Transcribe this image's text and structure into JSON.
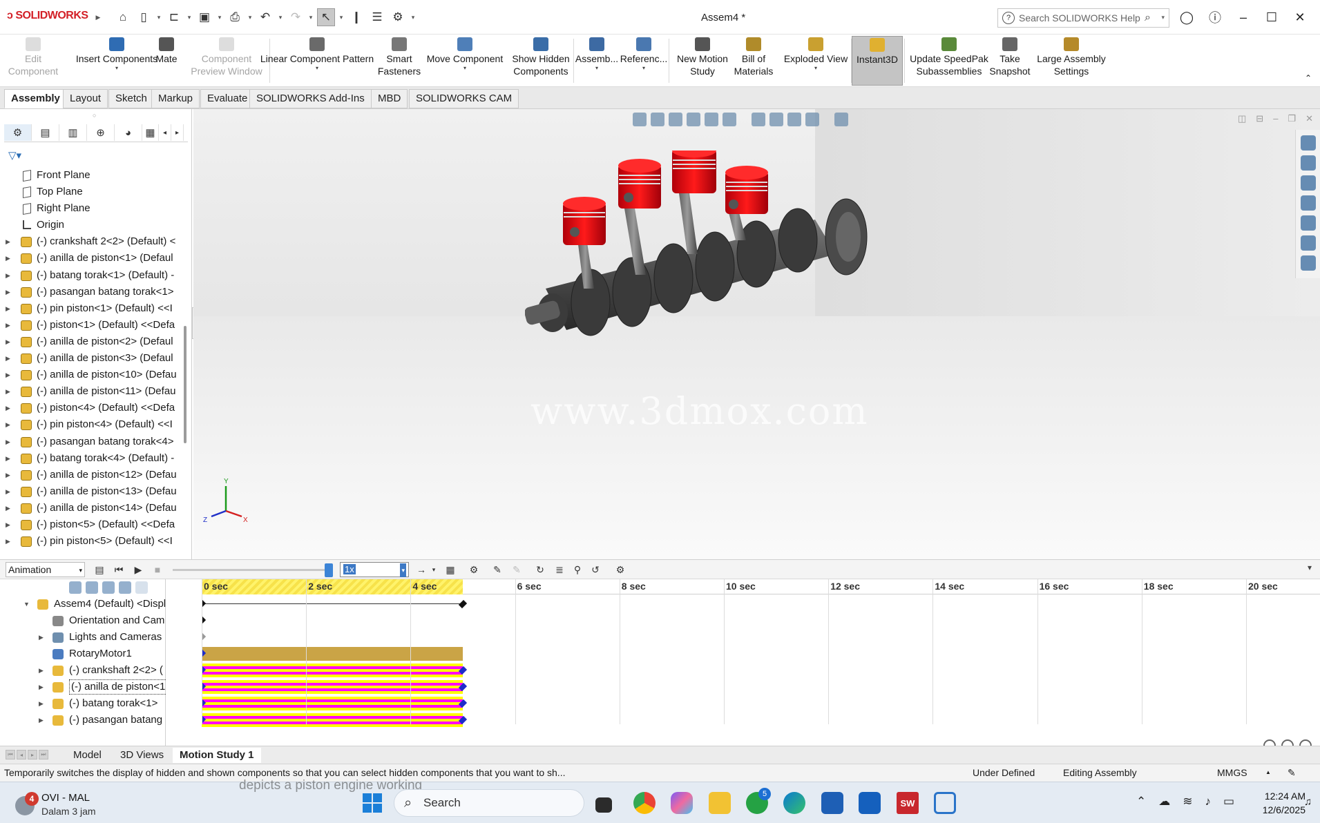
{
  "app": {
    "logo": "SOLIDWORKS",
    "document_title": "Assem4 *",
    "help_search_placeholder": "Search SOLIDWORKS Help",
    "help_icon": "?"
  },
  "command_manager": {
    "buttons": [
      {
        "id": "edit-component",
        "line1": "Edit",
        "line2": "Component",
        "disabled": true,
        "dropdown": false
      },
      {
        "id": "insert-components",
        "line1": "Insert Components",
        "line2": "",
        "disabled": false,
        "dropdown": true
      },
      {
        "id": "mate",
        "line1": "Mate",
        "line2": "",
        "disabled": false,
        "dropdown": false
      },
      {
        "id": "component-preview-window",
        "line1": "Component",
        "line2": "Preview Window",
        "disabled": true,
        "dropdown": false
      },
      {
        "id": "linear-component-pattern",
        "line1": "Linear Component Pattern",
        "line2": "",
        "disabled": false,
        "dropdown": true
      },
      {
        "id": "smart-fasteners",
        "line1": "Smart",
        "line2": "Fasteners",
        "disabled": false,
        "dropdown": false
      },
      {
        "id": "move-component",
        "line1": "Move Component",
        "line2": "",
        "disabled": false,
        "dropdown": true
      },
      {
        "id": "show-hidden-components",
        "line1": "Show Hidden",
        "line2": "Components",
        "disabled": false,
        "dropdown": false
      },
      {
        "id": "assembly",
        "line1": "Assemb...",
        "line2": "",
        "disabled": false,
        "dropdown": true
      },
      {
        "id": "reference",
        "line1": "Referenc...",
        "line2": "",
        "disabled": false,
        "dropdown": true
      },
      {
        "id": "new-motion-study",
        "line1": "New Motion",
        "line2": "Study",
        "disabled": false,
        "dropdown": false
      },
      {
        "id": "bill-of-materials",
        "line1": "Bill of",
        "line2": "Materials",
        "disabled": false,
        "dropdown": false
      },
      {
        "id": "exploded-view",
        "line1": "Exploded View",
        "line2": "",
        "disabled": false,
        "dropdown": true
      },
      {
        "id": "instant3d",
        "line1": "Instant3D",
        "line2": "",
        "disabled": false,
        "dropdown": false
      },
      {
        "id": "update-speedpak",
        "line1": "Update SpeedPak",
        "line2": "Subassemblies",
        "disabled": false,
        "dropdown": false
      },
      {
        "id": "take-snapshot",
        "line1": "Take",
        "line2": "Snapshot",
        "disabled": false,
        "dropdown": false
      },
      {
        "id": "large-assembly-settings",
        "line1": "Large Assembly",
        "line2": "Settings",
        "disabled": false,
        "dropdown": false
      }
    ]
  },
  "tabs": [
    "Assembly",
    "Layout",
    "Sketch",
    "Markup",
    "Evaluate",
    "SOLIDWORKS Add-Ins",
    "MBD",
    "SOLIDWORKS CAM"
  ],
  "active_tab": "Assembly",
  "feature_tree": [
    {
      "label": "Front Plane",
      "type": "plane",
      "expandable": false
    },
    {
      "label": "Top Plane",
      "type": "plane",
      "expandable": false
    },
    {
      "label": "Right Plane",
      "type": "plane",
      "expandable": false
    },
    {
      "label": "Origin",
      "type": "origin",
      "expandable": false
    },
    {
      "label": "(-) crankshaft 2<2> (Default) <",
      "type": "part",
      "expandable": true
    },
    {
      "label": "(-) anilla de piston<1> (Defaul",
      "type": "part",
      "expandable": true
    },
    {
      "label": "(-) batang torak<1> (Default) -",
      "type": "part",
      "expandable": true
    },
    {
      "label": "(-) pasangan batang torak<1>",
      "type": "part",
      "expandable": true
    },
    {
      "label": "(-) pin piston<1> (Default) <<I",
      "type": "part",
      "expandable": true
    },
    {
      "label": "(-) piston<1> (Default) <<Defa",
      "type": "part",
      "expandable": true
    },
    {
      "label": "(-) anilla de piston<2> (Defaul",
      "type": "part",
      "expandable": true
    },
    {
      "label": "(-) anilla de piston<3> (Defaul",
      "type": "part",
      "expandable": true
    },
    {
      "label": "(-) anilla de piston<10> (Defau",
      "type": "part",
      "expandable": true
    },
    {
      "label": "(-) anilla de piston<11> (Defau",
      "type": "part",
      "expandable": true
    },
    {
      "label": "(-) piston<4> (Default) <<Defa",
      "type": "part",
      "expandable": true
    },
    {
      "label": "(-) pin piston<4> (Default) <<I",
      "type": "part",
      "expandable": true
    },
    {
      "label": "(-) pasangan batang torak<4>",
      "type": "part",
      "expandable": true
    },
    {
      "label": "(-) batang torak<4> (Default) -",
      "type": "part",
      "expandable": true
    },
    {
      "label": "(-) anilla de piston<12> (Defau",
      "type": "part",
      "expandable": true
    },
    {
      "label": "(-) anilla de piston<13> (Defau",
      "type": "part",
      "expandable": true
    },
    {
      "label": "(-) anilla de piston<14> (Defau",
      "type": "part",
      "expandable": true
    },
    {
      "label": "(-) piston<5> (Default) <<Defa",
      "type": "part",
      "expandable": true
    },
    {
      "label": "(-) pin piston<5> (Default) <<I",
      "type": "part",
      "expandable": true
    }
  ],
  "viewport": {
    "watermark": "www.3dmox.com",
    "triad": {
      "x": "X",
      "y": "Y",
      "z": "Z"
    }
  },
  "motion_manager": {
    "study_type": "Animation",
    "speed": "1x",
    "time_ticks": [
      "0 sec",
      "2 sec",
      "4 sec",
      "6 sec",
      "8 sec",
      "10 sec",
      "12 sec",
      "14 sec",
      "16 sec",
      "18 sec",
      "20 sec"
    ],
    "duration_sec": 5,
    "tree": [
      {
        "label": "Assem4 (Default) <Displ",
        "indent": 0,
        "expandable": true,
        "expanded": true,
        "icon": "assembly",
        "track": "key"
      },
      {
        "label": "Orientation and Cam",
        "indent": 1,
        "expandable": false,
        "icon": "orientation",
        "track": "key-start"
      },
      {
        "label": "Lights and Cameras",
        "indent": 1,
        "expandable": true,
        "icon": "lights",
        "track": "key-grey"
      },
      {
        "label": "RotaryMotor1",
        "indent": 1,
        "expandable": false,
        "icon": "motor",
        "track": "motor"
      },
      {
        "label": "(-) crankshaft 2<2> (",
        "indent": 1,
        "expandable": true,
        "icon": "part",
        "track": "component"
      },
      {
        "label": "(-) anilla de piston<1",
        "indent": 1,
        "expandable": true,
        "icon": "part",
        "track": "component",
        "selected": true
      },
      {
        "label": "(-) batang torak<1>",
        "indent": 1,
        "expandable": true,
        "icon": "part",
        "track": "component"
      },
      {
        "label": "(-) pasangan batang",
        "indent": 1,
        "expandable": true,
        "icon": "part",
        "track": "component"
      }
    ]
  },
  "bottom_tabs": [
    "Model",
    "3D Views",
    "Motion Study 1"
  ],
  "active_bottom_tab": "Motion Study 1",
  "status_bar": {
    "message": "Temporarily switches the display of hidden and shown components so that you can select hidden components that you want to sh...",
    "definition": "Under Defined",
    "mode": "Editing Assembly",
    "units": "MMGS"
  },
  "taskbar": {
    "weather_badge": "4",
    "weather_title": "OVI - MAL",
    "weather_sub": "Dalam 3 jam",
    "ghost_text": "depicts a piston engine working",
    "search_label": "Search",
    "whatsapp_badge": "5",
    "solidworks_badge": "SW",
    "time": "12:24 AM",
    "date": "12/6/2025"
  }
}
